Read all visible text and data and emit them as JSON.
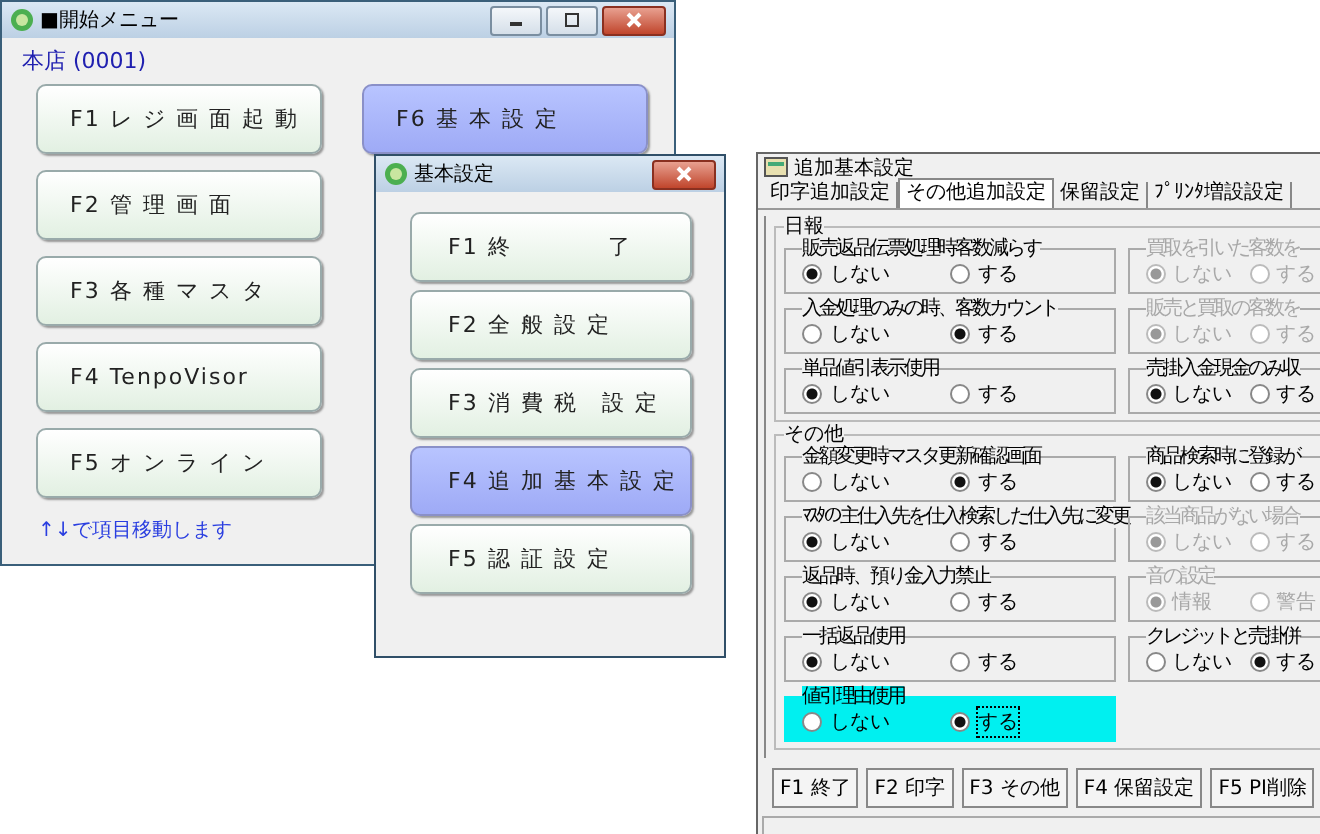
{
  "start_menu": {
    "title": "■開始メニュー",
    "store": "本店 (0001)",
    "buttons": [
      {
        "label": "F1 レ ジ 画 面 起 動",
        "selected": false
      },
      {
        "label": "F2 管 理 画 面",
        "selected": false
      },
      {
        "label": "F3 各 種 マ ス タ",
        "selected": false
      },
      {
        "label": "F4 TenpoVisor",
        "selected": false
      },
      {
        "label": "F5 オ ン ラ イ ン",
        "selected": false
      },
      {
        "label": "F6 基 本 設 定",
        "selected": true
      }
    ],
    "hint": "↑↓で項目移動します"
  },
  "basic_settings": {
    "title": "基本設定",
    "buttons": [
      {
        "label": "F1 終　　　　了",
        "selected": false
      },
      {
        "label": "F2 全 般 設 定",
        "selected": false
      },
      {
        "label": "F3 消 費 税　設 定",
        "selected": false
      },
      {
        "label": "F4 追 加 基 本 設 定",
        "selected": true
      },
      {
        "label": "F5 認 証 設 定",
        "selected": false
      }
    ]
  },
  "additional_settings": {
    "title": "追加基本設定",
    "tabs": [
      {
        "label": "印字追加設定",
        "selected": false
      },
      {
        "label": "その他追加設定",
        "selected": true
      },
      {
        "label": "保留設定",
        "selected": false
      },
      {
        "label": "ﾌﾟﾘﾝﾀ増設設定",
        "selected": false
      }
    ],
    "sections": [
      {
        "title": "日報",
        "groups": [
          {
            "title": "販売返品伝票処理時客数減らす",
            "disabled": false,
            "highlighted": false,
            "options": [
              {
                "label": "しない",
                "selected": true
              },
              {
                "label": "する",
                "selected": false
              }
            ]
          },
          {
            "title": "買取を引いた客数を",
            "disabled": true,
            "highlighted": false,
            "options": [
              {
                "label": "しない",
                "selected": true
              },
              {
                "label": "する",
                "selected": false
              }
            ]
          },
          {
            "title": "入金処理のみの時、客数カウント",
            "disabled": false,
            "highlighted": false,
            "options": [
              {
                "label": "しない",
                "selected": false
              },
              {
                "label": "する",
                "selected": true
              }
            ]
          },
          {
            "title": "販売と買取の客数を",
            "disabled": true,
            "highlighted": false,
            "options": [
              {
                "label": "しない",
                "selected": true
              },
              {
                "label": "する",
                "selected": false
              }
            ]
          },
          {
            "title": "単品値引表示使用",
            "disabled": false,
            "highlighted": false,
            "options": [
              {
                "label": "しない",
                "selected": true
              },
              {
                "label": "する",
                "selected": false
              }
            ]
          },
          {
            "title": "売掛入金現金のみ収",
            "disabled": false,
            "highlighted": false,
            "options": [
              {
                "label": "しない",
                "selected": true
              },
              {
                "label": "する",
                "selected": false
              }
            ]
          }
        ]
      },
      {
        "title": "その他",
        "groups": [
          {
            "title": "金額変更時マスタ更新確認画面",
            "disabled": false,
            "highlighted": false,
            "options": [
              {
                "label": "しない",
                "selected": false
              },
              {
                "label": "する",
                "selected": true
              }
            ]
          },
          {
            "title": "商品検索時に登録が",
            "disabled": false,
            "highlighted": false,
            "options": [
              {
                "label": "しない",
                "selected": true
              },
              {
                "label": "する",
                "selected": false
              }
            ]
          },
          {
            "title": "ﾏｽﾀの主仕入先を仕入検索した仕入先に変更",
            "disabled": false,
            "highlighted": false,
            "options": [
              {
                "label": "しない",
                "selected": true
              },
              {
                "label": "する",
                "selected": false
              }
            ]
          },
          {
            "title": "該当商品がない場合",
            "disabled": true,
            "highlighted": false,
            "options": [
              {
                "label": "しない",
                "selected": true
              },
              {
                "label": "する",
                "selected": false
              }
            ]
          },
          {
            "title": "返品時、預り金入力禁止",
            "disabled": false,
            "highlighted": false,
            "options": [
              {
                "label": "しない",
                "selected": true
              },
              {
                "label": "する",
                "selected": false
              }
            ]
          },
          {
            "title": "音の設定",
            "disabled": true,
            "highlighted": false,
            "options": [
              {
                "label": "情報",
                "selected": true
              },
              {
                "label": "警告",
                "selected": false
              }
            ]
          },
          {
            "title": "一括返品使用",
            "disabled": false,
            "highlighted": false,
            "options": [
              {
                "label": "しない",
                "selected": true
              },
              {
                "label": "する",
                "selected": false
              }
            ]
          },
          {
            "title": "クレジットと売掛併",
            "disabled": false,
            "highlighted": false,
            "options": [
              {
                "label": "しない",
                "selected": false
              },
              {
                "label": "する",
                "selected": true
              }
            ]
          },
          {
            "title": "値引理由使用",
            "disabled": false,
            "highlighted": true,
            "options": [
              {
                "label": "しない",
                "selected": false
              },
              {
                "label": "する",
                "selected": true
              }
            ]
          }
        ]
      }
    ],
    "buttons": [
      "F1 終了",
      "F2 印字",
      "F3 その他",
      "F4 保留設定",
      "F5 PI削除"
    ]
  }
}
